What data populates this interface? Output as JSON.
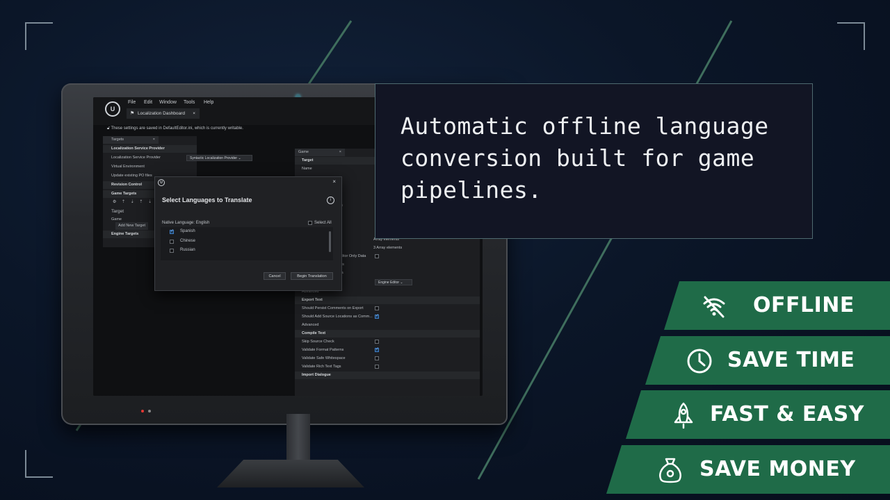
{
  "editor": {
    "menu": [
      "File",
      "Edit",
      "Window",
      "Tools",
      "Help"
    ],
    "logo": "U",
    "tab_title": "Localization Dashboard",
    "tab_close": "×",
    "notice": "These settings are saved in DefaultEditor.ini, which is currently writable.",
    "left_panel": {
      "tab": "Targets",
      "sections": {
        "service": "Localization Service Provider",
        "service_label": "Localization Service Provider",
        "service_value": "Syntactic Localization Provider",
        "virtual_env": "Virtual Environment",
        "update_po": "Update existing PO files",
        "revision": "Revision Control",
        "game_targets": "Game Targets",
        "target_col": "Target",
        "game": "Game",
        "add_target": "Add New Target",
        "engine_targets": "Engine Targets"
      }
    },
    "right_panel": {
      "tab": "Game",
      "target_header": "Target",
      "name_label": "Name",
      "partial_lines": [
        "ies",
        "Array elements",
        "3 Array elements",
        "Editor Only Data",
        "ges",
        "ata"
      ],
      "engine_btn": "Engine",
      "editor_btn": "Editor",
      "advanced": "Advanced",
      "export_text": "Export Text",
      "persist_comments": "Should Persist Comments on Export",
      "add_source": "Should Add Source Locations as Comm...",
      "advanced2": "Advanced",
      "compile_text": "Compile Text",
      "skip_source": "Skip Source Check",
      "validate_format": "Validate Format Patterns",
      "validate_whitespace": "Validate Safe Whitespace",
      "validate_rich": "Validate Rich Text Tags",
      "import_dialogue": "Import Dialogue"
    },
    "dialog": {
      "title": "Select Languages to Translate",
      "native_language": "Native Language: English",
      "select_all": "Select All",
      "languages": [
        {
          "name": "Spanish",
          "checked": true
        },
        {
          "name": "Chinese",
          "checked": false
        },
        {
          "name": "Russian",
          "checked": false
        }
      ],
      "cancel": "Cancel",
      "begin": "Begin Translation",
      "close": "×"
    }
  },
  "callout": {
    "text": "Automatic offline language conversion built for game pipelines."
  },
  "features": [
    {
      "label": "OFFLINE",
      "icon": "wifi-off-icon"
    },
    {
      "label": "SAVE TIME",
      "icon": "clock-icon"
    },
    {
      "label": "FAST & EASY",
      "icon": "rocket-icon"
    },
    {
      "label": "SAVE MONEY",
      "icon": "money-bag-icon"
    }
  ],
  "colors": {
    "badge": "#1f6b48",
    "accent_line": "#3d6b5a",
    "background": "#0b1628"
  }
}
